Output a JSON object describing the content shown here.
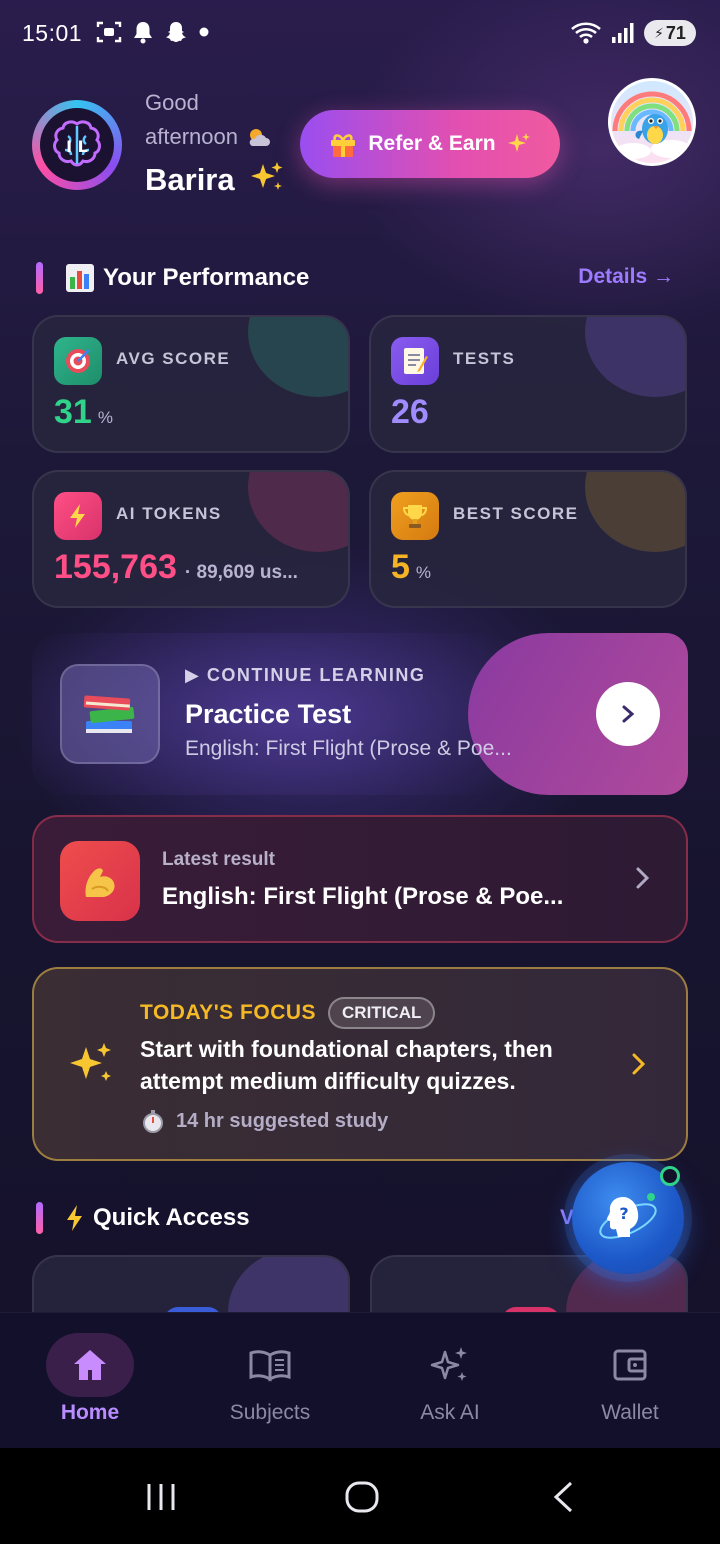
{
  "status_bar": {
    "time": "15:01",
    "battery": "71",
    "left_icons": [
      "screenshot-icon",
      "bell-icon",
      "snapchat-icon",
      "dot-icon"
    ],
    "right_icons": [
      "wifi-icon",
      "signal-icon",
      "battery-icon"
    ]
  },
  "header": {
    "greeting_line1": "Good",
    "greeting_line2": "afternoon",
    "user_name": "Barira",
    "refer_label": "Refer & Earn"
  },
  "performance": {
    "title": "Your Performance",
    "details_label": "Details",
    "cards": [
      {
        "label": "AVG SCORE",
        "value": "31",
        "unit": "%",
        "color": "#2fd38a"
      },
      {
        "label": "TESTS",
        "value": "26",
        "unit": "",
        "color": "#a08bff"
      },
      {
        "label": "AI TOKENS",
        "value": "155,763",
        "sub": "· 89,609 us...",
        "color": "#ff4f86"
      },
      {
        "label": "BEST SCORE",
        "value": "5",
        "unit": "%",
        "color": "#f5b425"
      }
    ]
  },
  "continue_learning": {
    "kicker": "CONTINUE LEARNING",
    "title": "Practice Test",
    "subtitle": "English: First Flight (Prose & Poe..."
  },
  "latest_result": {
    "label": "Latest result",
    "title": "English: First Flight (Prose & Poe..."
  },
  "focus": {
    "title": "TODAY'S FOCUS",
    "badge": "CRITICAL",
    "text": "Start with foundational chapters, then attempt medium difficulty quizzes.",
    "meta": "14 hr suggested study"
  },
  "quick_access": {
    "title": "Quick Access",
    "view_partial": "V"
  },
  "bottom_nav": {
    "items": [
      {
        "label": "Home",
        "icon": "home-icon",
        "active": true
      },
      {
        "label": "Subjects",
        "icon": "book-icon",
        "active": false
      },
      {
        "label": "Ask AI",
        "icon": "sparkles-icon",
        "active": false
      },
      {
        "label": "Wallet",
        "icon": "wallet-icon",
        "active": false
      }
    ]
  },
  "colors": {
    "accent": "#b98cff",
    "pink": "#e24fb0",
    "gold": "#f5b925"
  }
}
